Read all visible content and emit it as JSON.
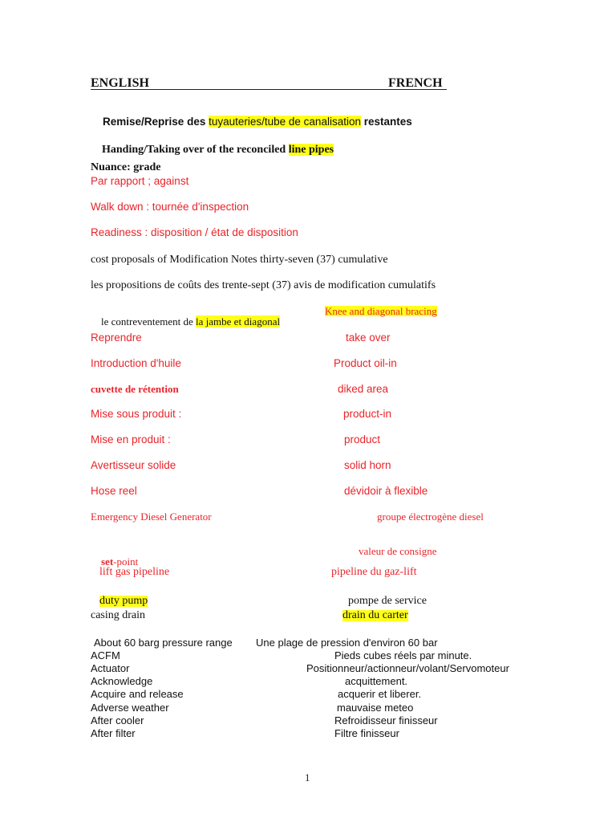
{
  "header": {
    "left": "ENGLISH",
    "right": "FRENCH"
  },
  "title_fr": {
    "prefix": "Remise/Reprise des ",
    "highlight": "tuyauteries/tube de canalisation",
    "suffix": " restantes"
  },
  "title_en": {
    "prefix": "Handing/Taking over of the reconciled ",
    "highlight": "line pipes"
  },
  "nuance": "Nuance: grade",
  "notes": [
    "Par rapport ; against",
    "Walk down : tournée d'inspection",
    "Readiness : disposition / état de disposition",
    "cost proposals of Modification Notes thirty-seven (37) cumulative",
    "les propositions de coûts des trente-sept (37) avis de modification cumulatifs"
  ],
  "bracing": {
    "prefix": "le contreventement de ",
    "highlight": "la jambe et diagonal",
    "translation": "Knee and diagonal bracing"
  },
  "pairs_red": [
    {
      "left": "Reprendre",
      "right": "take over"
    },
    {
      "left": "Introduction d'huile",
      "right": "Product oil-in"
    },
    {
      "left": "cuvette de rétention",
      "right": "diked area"
    },
    {
      "left": "Mise sous produit :",
      "right": "product-in"
    },
    {
      "left": "Mise en produit :",
      "right": "product"
    },
    {
      "left": "Avertisseur solide",
      "right": "solid horn"
    },
    {
      "left": "Hose reel",
      "right": "dévidoir à flexible"
    },
    {
      "left": "Emergency Diesel Generator",
      "right": "groupe électrogène diesel"
    }
  ],
  "setpoint": {
    "bold": "set",
    "rest": "-point",
    "right": "valeur de consigne"
  },
  "lift_gas": {
    "left": "lift gas pipeline",
    "right": "pipeline du gaz-lift"
  },
  "duty_pump": {
    "left": "duty pump",
    "right": "pompe de service"
  },
  "casing_drain": {
    "left": "casing drain",
    "right": "drain du carter"
  },
  "glossary": [
    {
      "left": "About 60 barg pressure range",
      "right": "Une plage de pression d'environ 60 bar"
    },
    {
      "left": "ACFM",
      "right": "Pieds cubes réels par minute."
    },
    {
      "left": "Actuator",
      "right": "Positionneur/actionneur/volant/Servomoteur"
    },
    {
      "left": "Acknowledge",
      "right": "acquittement."
    },
    {
      "left": "Acquire and release",
      "right": "acquerir et liberer."
    },
    {
      "left": "Adverse weather",
      "right": "mauvaise meteo"
    },
    {
      "left": "After cooler",
      "right": "Refroidisseur finisseur"
    },
    {
      "left": "After filter",
      "right": "Filtre finisseur"
    }
  ],
  "page_number": "1",
  "colors": {
    "red_text": "#e8242a",
    "highlight": "#ffff1a",
    "body_text": "#111111"
  }
}
